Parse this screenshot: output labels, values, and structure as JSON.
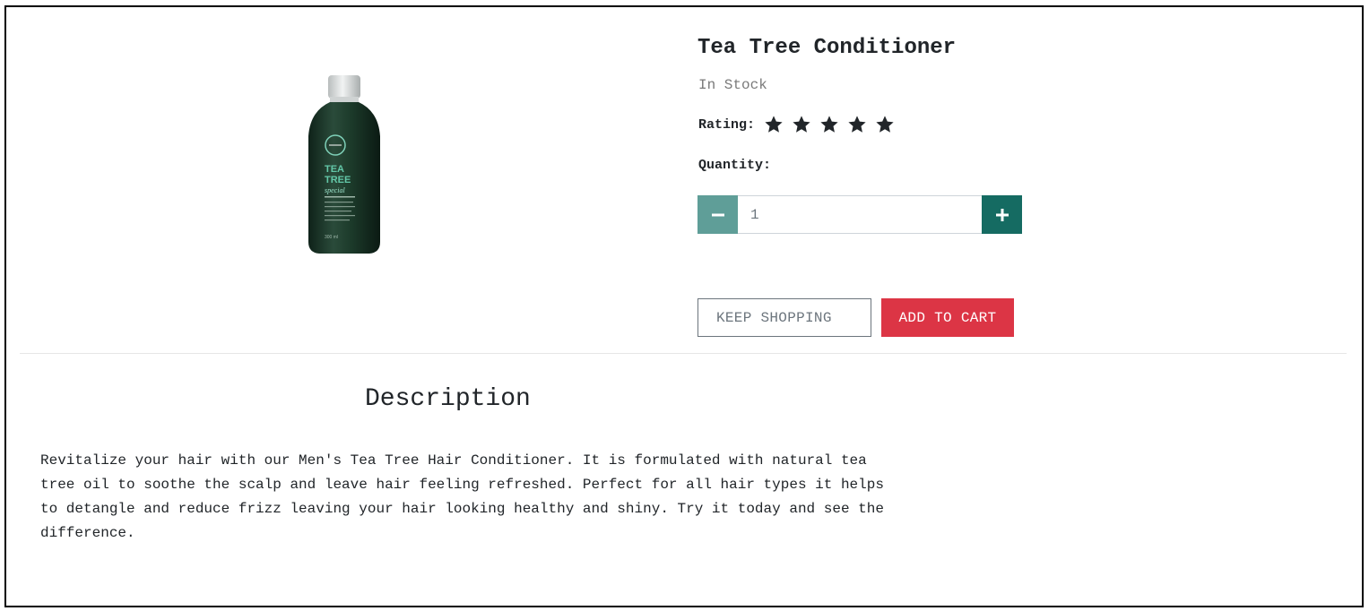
{
  "product": {
    "title": "Tea Tree Conditioner",
    "stock_status": "In Stock",
    "rating_label": "Rating:",
    "rating_value": 5,
    "rating_max": 5,
    "image_icon": "conditioner-bottle-image",
    "bottle_text": {
      "brand_line1": "TEA",
      "brand_line2": "TREE",
      "product_line": "special",
      "volume": "300 ml"
    }
  },
  "quantity": {
    "label": "Quantity:",
    "value": "1",
    "minus_icon": "minus-icon",
    "plus_icon": "plus-icon"
  },
  "actions": {
    "keep_shopping": "KEEP SHOPPING",
    "add_to_cart": "ADD TO CART"
  },
  "description": {
    "heading": "Description",
    "text": "Revitalize your hair with our Men's Tea Tree Hair Conditioner. It is formulated with natural tea tree oil to soothe the scalp and leave hair feeling refreshed. Perfect for all hair types it helps to detangle and reduce frizz leaving your hair looking healthy and shiny. Try it today and see the difference."
  },
  "colors": {
    "minus_button": "#5f9e98",
    "plus_button": "#156b62",
    "add_to_cart": "#dc3545",
    "star": "#212529",
    "bottle": "#1c3a2a"
  }
}
